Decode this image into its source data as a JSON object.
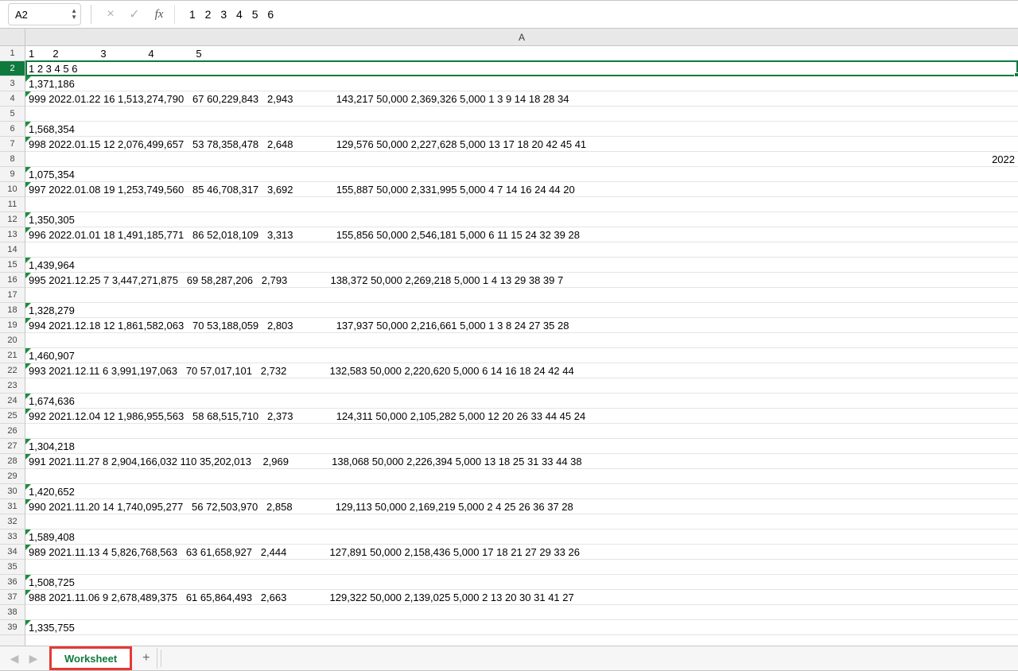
{
  "formula_bar": {
    "cell_ref": "A2",
    "cancel_icon": "×",
    "confirm_icon": "✓",
    "fx_label": "fx",
    "formula_value": "1 2 3 4 5 6"
  },
  "column_header": "A",
  "row_numbers": [
    "1",
    "2",
    "3",
    "4",
    "5",
    "6",
    "7",
    "8",
    "9",
    "10",
    "11",
    "12",
    "13",
    "14",
    "15",
    "16",
    "17",
    "18",
    "19",
    "20",
    "21",
    "22",
    "23",
    "24",
    "25",
    "26",
    "27",
    "28",
    "29",
    "30",
    "31",
    "32",
    "33",
    "34",
    "35",
    "36",
    "37",
    "38",
    "39"
  ],
  "selected_row_index": 1,
  "row1_numbers": [
    "1",
    "2",
    "3",
    "4",
    "5"
  ],
  "rows": [
    {
      "text": "",
      "tri": false,
      "right": false,
      "special": "numberline"
    },
    {
      "text": "1 2 3 4 5 6",
      "tri": false,
      "right": false,
      "selected": true
    },
    {
      "text": "1,371,186",
      "tri": true,
      "right": false
    },
    {
      "text": "999 2022.01.22 16 1,513,274,790   67 60,229,843   2,943               143,217 50,000 2,369,326 5,000 1 3 9 14 18 28 34",
      "tri": true,
      "right": false
    },
    {
      "text": "",
      "tri": false,
      "right": false
    },
    {
      "text": "1,568,354",
      "tri": true,
      "right": false
    },
    {
      "text": "998 2022.01.15 12 2,076,499,657   53 78,358,478   2,648               129,576 50,000 2,227,628 5,000 13 17 18 20 42 45 41",
      "tri": true,
      "right": false
    },
    {
      "text": "2022",
      "tri": false,
      "right": true
    },
    {
      "text": "1,075,354",
      "tri": true,
      "right": false
    },
    {
      "text": "997 2022.01.08 19 1,253,749,560   85 46,708,317   3,692               155,887 50,000 2,331,995 5,000 4 7 14 16 24 44 20",
      "tri": true,
      "right": false
    },
    {
      "text": "",
      "tri": false,
      "right": false
    },
    {
      "text": "1,350,305",
      "tri": true,
      "right": false
    },
    {
      "text": "996 2022.01.01 18 1,491,185,771   86 52,018,109   3,313               155,856 50,000 2,546,181 5,000 6 11 15 24 32 39 28",
      "tri": true,
      "right": false
    },
    {
      "text": "",
      "tri": false,
      "right": false
    },
    {
      "text": "1,439,964",
      "tri": true,
      "right": false
    },
    {
      "text": "995 2021.12.25 7 3,447,271,875   69 58,287,206   2,793               138,372 50,000 2,269,218 5,000 1 4 13 29 38 39 7",
      "tri": true,
      "right": false
    },
    {
      "text": "",
      "tri": false,
      "right": false
    },
    {
      "text": "1,328,279",
      "tri": true,
      "right": false
    },
    {
      "text": "994 2021.12.18 12 1,861,582,063   70 53,188,059   2,803               137,937 50,000 2,216,661 5,000 1 3 8 24 27 35 28",
      "tri": true,
      "right": false
    },
    {
      "text": "",
      "tri": false,
      "right": false
    },
    {
      "text": "1,460,907",
      "tri": true,
      "right": false
    },
    {
      "text": "993 2021.12.11 6 3,991,197,063   70 57,017,101   2,732               132,583 50,000 2,220,620 5,000 6 14 16 18 24 42 44",
      "tri": true,
      "right": false
    },
    {
      "text": "",
      "tri": false,
      "right": false
    },
    {
      "text": "1,674,636",
      "tri": true,
      "right": false
    },
    {
      "text": "992 2021.12.04 12 1,986,955,563   58 68,515,710   2,373               124,311 50,000 2,105,282 5,000 12 20 26 33 44 45 24",
      "tri": true,
      "right": false
    },
    {
      "text": "",
      "tri": false,
      "right": false
    },
    {
      "text": "1,304,218",
      "tri": true,
      "right": false
    },
    {
      "text": "991 2021.11.27 8 2,904,166,032 110 35,202,013    2,969               138,068 50,000 2,226,394 5,000 13 18 25 31 33 44 38",
      "tri": true,
      "right": false
    },
    {
      "text": "",
      "tri": false,
      "right": false
    },
    {
      "text": "1,420,652",
      "tri": true,
      "right": false
    },
    {
      "text": "990 2021.11.20 14 1,740,095,277   56 72,503,970   2,858               129,113 50,000 2,169,219 5,000 2 4 25 26 36 37 28",
      "tri": true,
      "right": false
    },
    {
      "text": "",
      "tri": false,
      "right": false
    },
    {
      "text": "1,589,408",
      "tri": true,
      "right": false
    },
    {
      "text": "989 2021.11.13 4 5,826,768,563   63 61,658,927   2,444               127,891 50,000 2,158,436 5,000 17 18 21 27 29 33 26",
      "tri": true,
      "right": false
    },
    {
      "text": "",
      "tri": false,
      "right": false
    },
    {
      "text": "1,508,725",
      "tri": true,
      "right": false
    },
    {
      "text": "988 2021.11.06 9 2,678,489,375   61 65,864,493   2,663               129,322 50,000 2,139,025 5,000 2 13 20 30 31 41 27",
      "tri": true,
      "right": false
    },
    {
      "text": "",
      "tri": false,
      "right": false
    },
    {
      "text": "1,335,755",
      "tri": true,
      "right": false
    }
  ],
  "tabs": {
    "active": "Worksheet",
    "add_label": "+"
  }
}
